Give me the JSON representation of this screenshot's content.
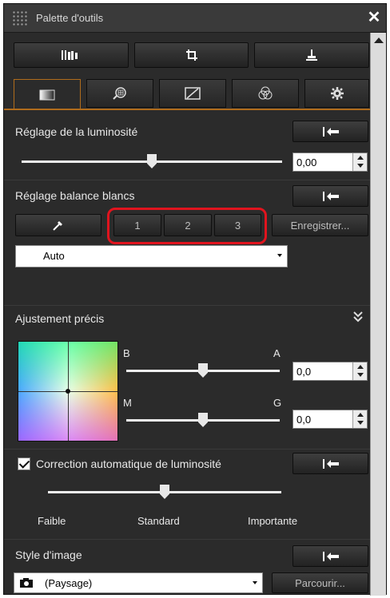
{
  "window": {
    "title": "Palette d'outils",
    "close_icon": "close-icon"
  },
  "toolbar": {
    "icons": [
      "histogram-icon",
      "crop-icon",
      "stamp-icon"
    ]
  },
  "tabs": [
    {
      "icon": "brightness-tab-icon",
      "active": true
    },
    {
      "icon": "zoom-grid-tab-icon",
      "active": false
    },
    {
      "icon": "tone-curve-tab-icon",
      "active": false
    },
    {
      "icon": "color-circles-tab-icon",
      "active": false
    },
    {
      "icon": "gear-icon",
      "active": false
    }
  ],
  "brightness": {
    "label": "Réglage de la luminosité",
    "value": "0,00",
    "slider_fraction": 0.5
  },
  "white_balance": {
    "label": "Réglage balance blancs",
    "presets": [
      "1",
      "2",
      "3"
    ],
    "save_label": "Enregistrer...",
    "selected": "Auto"
  },
  "fine_adjust": {
    "label": "Ajustement précis",
    "b_label": "B",
    "a_label": "A",
    "m_label": "M",
    "g_label": "G",
    "ba_value": "0,0",
    "mg_value": "0,0",
    "ba_fraction": 0.5,
    "mg_fraction": 0.5
  },
  "auto_brightness": {
    "label": "Correction automatique de luminosité",
    "checked": true,
    "levels": [
      "Faible",
      "Standard",
      "Importante"
    ],
    "level_fraction": 0.5
  },
  "picture_style": {
    "label": "Style d'image",
    "selected": "(Paysage)",
    "browse_label": "Parcourir..."
  },
  "colors": {
    "accent_tab": "#b06c1c",
    "highlight": "#e0141e",
    "panel": "#2b2b2b"
  }
}
